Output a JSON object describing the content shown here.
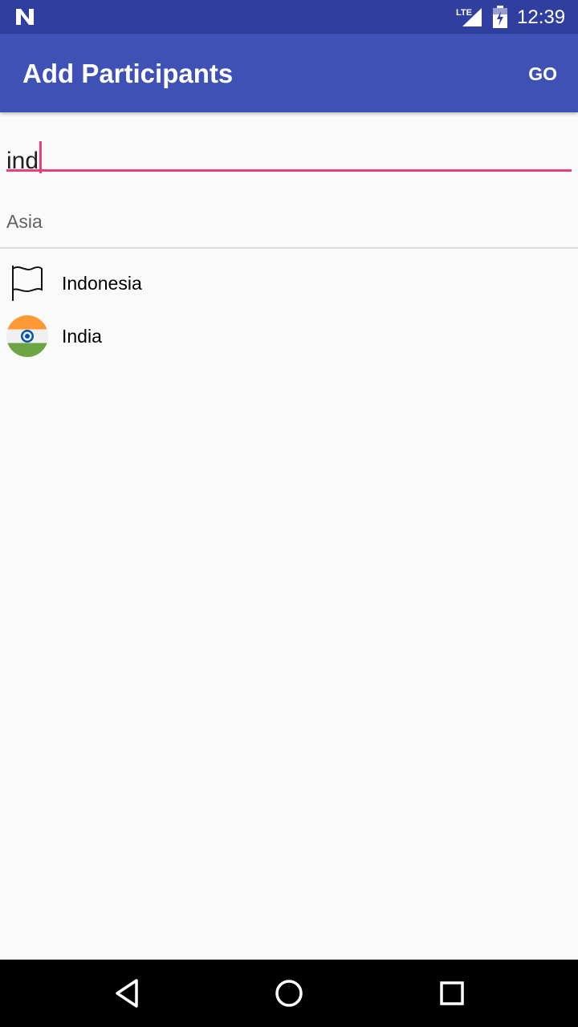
{
  "status_bar": {
    "network_label": "LTE",
    "clock": "12:39",
    "icons": [
      "notification-n-icon",
      "lte-signal-icon",
      "battery-charging-icon"
    ]
  },
  "app_bar": {
    "title": "Add Participants",
    "go_label": "GO"
  },
  "search": {
    "value": "ind"
  },
  "section": {
    "header": "Asia"
  },
  "results": [
    {
      "label": "Indonesia",
      "icon": "flag-outline-icon"
    },
    {
      "label": "India",
      "icon": "india-flag-icon"
    }
  ],
  "nav_bar": {
    "icons": [
      "back-icon",
      "home-icon",
      "recents-icon"
    ]
  },
  "colors": {
    "status_bar": "#303f9f",
    "app_bar": "#3f51b5",
    "accent": "#ec407a",
    "background": "#fafafa",
    "india_saffron": "#ff9933",
    "india_green": "#6da544",
    "india_chakra": "#0052b4"
  }
}
